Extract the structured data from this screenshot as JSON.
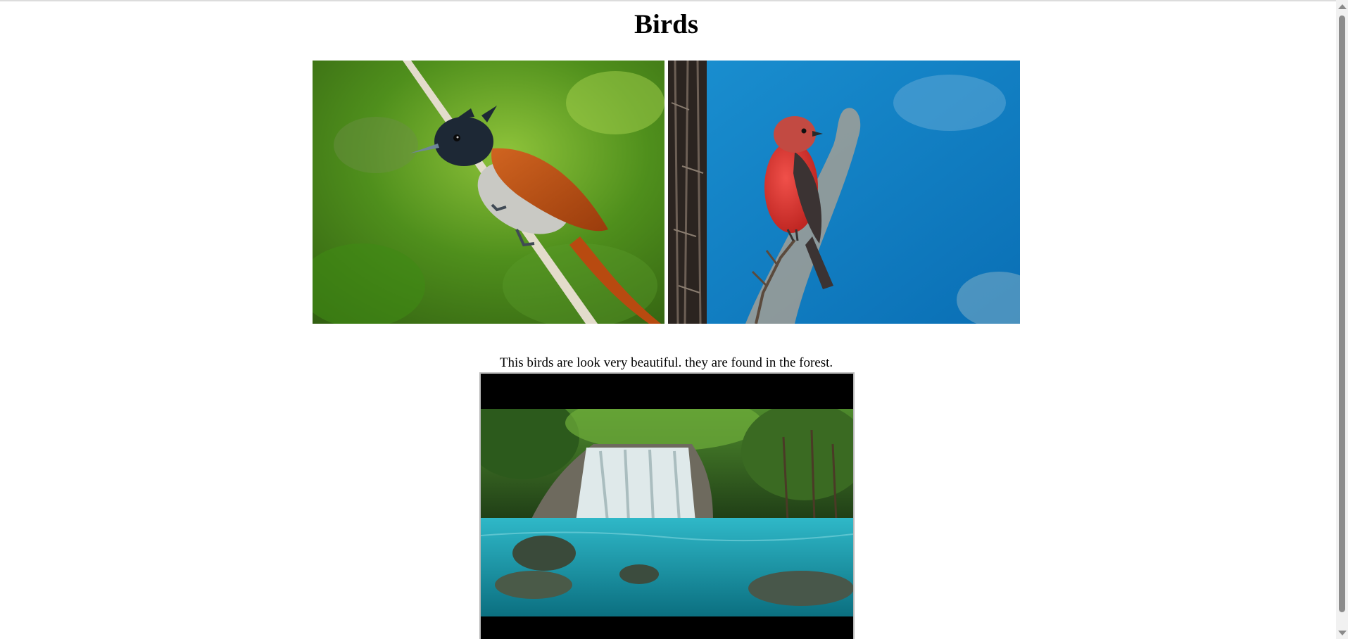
{
  "page": {
    "heading": "Birds",
    "caption": "This birds are look very beautiful. they are found in the forest."
  },
  "images": [
    {
      "name": "bird-photo-paradise-flycatcher",
      "subject": "orange-and-black crested bird perched on a pale branch against green foliage"
    },
    {
      "name": "bird-photo-vermilion-flycatcher",
      "subject": "red bird perched on a thin twig beside a tree trunk against blue sky"
    }
  ],
  "video": {
    "subject": "forest waterfall flowing into a turquoise pool with rocks"
  },
  "colors": {
    "background": "#ffffff",
    "text": "#000000",
    "video_letterbox": "#000000",
    "scrollbar_thumb": "#8c8c8c"
  },
  "scrollbar": {
    "up_icon": "triangle-up",
    "down_icon": "triangle-down"
  }
}
